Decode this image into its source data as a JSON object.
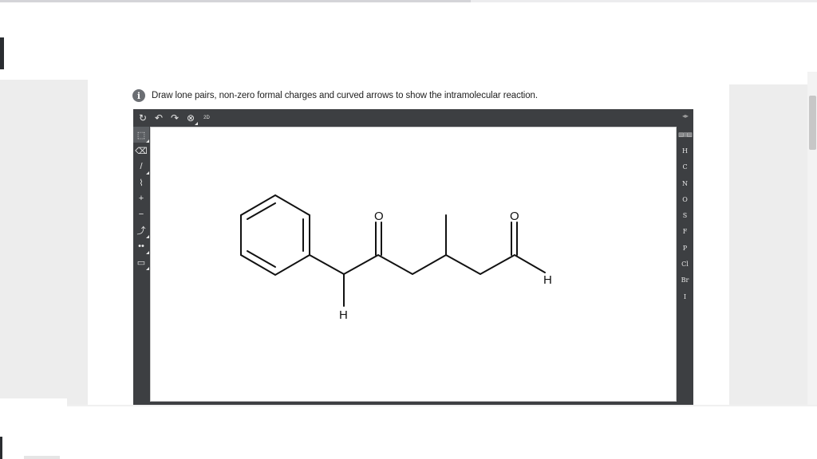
{
  "question": {
    "info_icon": "info-icon",
    "text": "Draw lone pairs, non-zero formal charges and curved arrows to show the intramolecular reaction."
  },
  "top_toolbar": [
    {
      "icon": "clear-icon",
      "glyph": "↻"
    },
    {
      "icon": "undo-icon",
      "glyph": "↶"
    },
    {
      "icon": "redo-icon",
      "glyph": "↷"
    },
    {
      "icon": "zoom-icon",
      "glyph": "⊗"
    },
    {
      "icon": "2d-clean-icon",
      "label": "2D"
    }
  ],
  "left_toolbar": [
    {
      "icon": "select-icon",
      "glyph": "⬚",
      "active": true
    },
    {
      "icon": "eraser-icon",
      "glyph": "⌫"
    },
    {
      "icon": "bond-icon",
      "glyph": "/"
    },
    {
      "icon": "chain-icon",
      "glyph": "⌇"
    },
    {
      "icon": "plus-charge-icon",
      "glyph": "+"
    },
    {
      "icon": "minus-charge-icon",
      "glyph": "−"
    },
    {
      "icon": "curved-arrow-icon",
      "glyph": "⤴"
    },
    {
      "icon": "lone-pair-icon",
      "glyph": "••"
    },
    {
      "icon": "template-icon",
      "glyph": "▭"
    }
  ],
  "right_toolbar": {
    "expand_icon": "◂▸",
    "periodic_table": "periodic-table-icon",
    "elements": [
      "H",
      "C",
      "N",
      "O",
      "S",
      "F",
      "P",
      "Cl",
      "Br",
      "I"
    ]
  },
  "molecule": {
    "atoms": {
      "O1": "O",
      "O2": "O",
      "H_alpha": "H",
      "H_aldehyde": "H"
    }
  }
}
